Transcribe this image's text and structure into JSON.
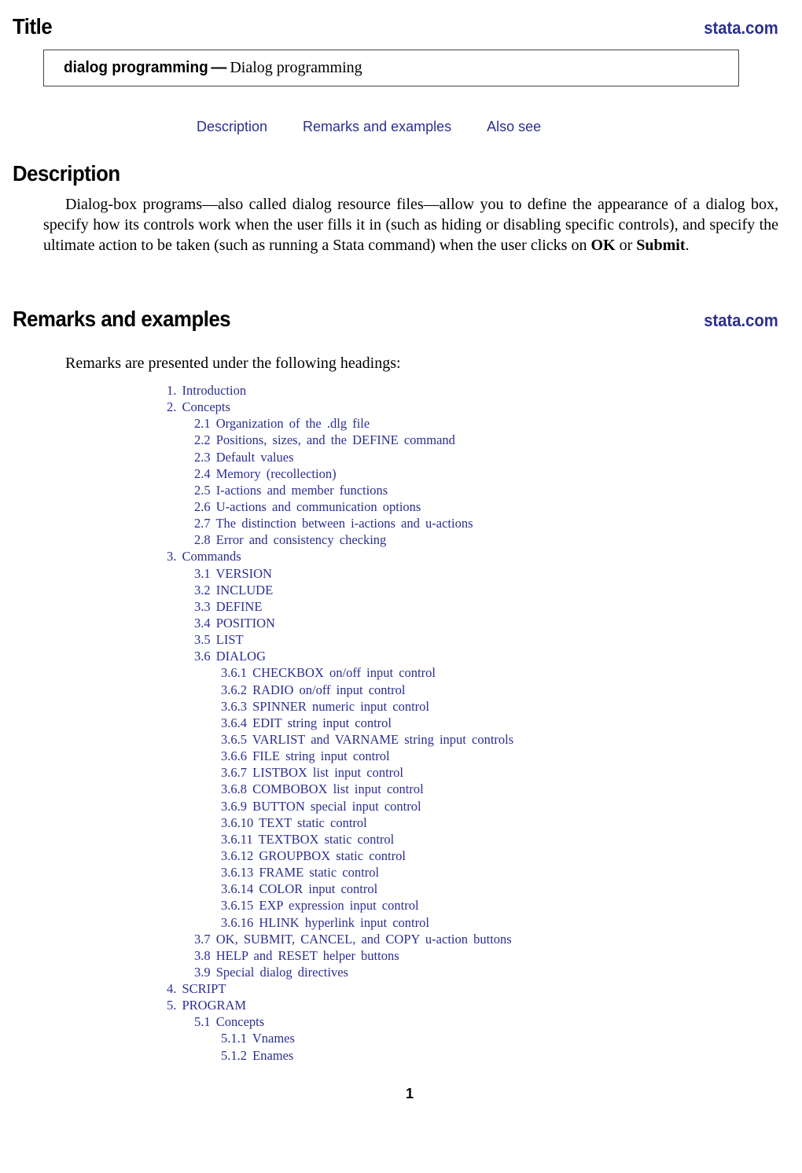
{
  "header": {
    "section_title": "Title",
    "site_link": "stata.com"
  },
  "title_box": {
    "command": "dialog programming",
    "dash": "—",
    "description": "Dialog programming"
  },
  "nav_links": [
    {
      "label": "Description"
    },
    {
      "label": "Remarks and examples"
    },
    {
      "label": "Also see"
    }
  ],
  "description": {
    "heading": "Description",
    "text_before_ok": "Dialog-box programs—also called dialog resource files—allow you to define the appearance of a dialog box, specify how its controls work when the user fills it in (such as hiding or disabling specific controls), and specify the ultimate action to be taken (such as running a Stata command) when the user clicks on ",
    "ok_label": "OK",
    "between": " or ",
    "submit_label": "Submit",
    "end": "."
  },
  "remarks": {
    "heading": "Remarks and examples",
    "site_link": "stata.com",
    "intro": "Remarks are presented under the following headings:",
    "toc": [
      {
        "level": 1,
        "label": "1.  Introduction"
      },
      {
        "level": 1,
        "label": "2.  Concepts"
      },
      {
        "level": 2,
        "label": "2.1 Organization of the .dlg file"
      },
      {
        "level": 2,
        "label": "2.2 Positions, sizes, and the DEFINE command"
      },
      {
        "level": 2,
        "label": "2.3 Default values"
      },
      {
        "level": 2,
        "label": "2.4 Memory (recollection)"
      },
      {
        "level": 2,
        "label": "2.5 I-actions and member functions"
      },
      {
        "level": 2,
        "label": "2.6 U-actions and communication options"
      },
      {
        "level": 2,
        "label": "2.7 The distinction between i-actions and u-actions"
      },
      {
        "level": 2,
        "label": "2.8 Error and consistency checking"
      },
      {
        "level": 1,
        "label": "3.  Commands"
      },
      {
        "level": 2,
        "label": "3.1 VERSION"
      },
      {
        "level": 2,
        "label": "3.2 INCLUDE"
      },
      {
        "level": 2,
        "label": "3.3 DEFINE"
      },
      {
        "level": 2,
        "label": "3.4 POSITION"
      },
      {
        "level": 2,
        "label": "3.5 LIST"
      },
      {
        "level": 2,
        "label": "3.6 DIALOG"
      },
      {
        "level": 3,
        "label": "3.6.1 CHECKBOX on/off input control"
      },
      {
        "level": 3,
        "label": "3.6.2 RADIO on/off input control"
      },
      {
        "level": 3,
        "label": "3.6.3 SPINNER numeric input control"
      },
      {
        "level": 3,
        "label": "3.6.4 EDIT string input control"
      },
      {
        "level": 3,
        "label": "3.6.5 VARLIST and VARNAME string input controls"
      },
      {
        "level": 3,
        "label": "3.6.6 FILE string input control"
      },
      {
        "level": 3,
        "label": "3.6.7 LISTBOX list input control"
      },
      {
        "level": 3,
        "label": "3.6.8 COMBOBOX list input control"
      },
      {
        "level": 3,
        "label": "3.6.9 BUTTON special input control"
      },
      {
        "level": 3,
        "label": "3.6.10 TEXT static control"
      },
      {
        "level": 3,
        "label": "3.6.11 TEXTBOX static control"
      },
      {
        "level": 3,
        "label": "3.6.12 GROUPBOX static control"
      },
      {
        "level": 3,
        "label": "3.6.13 FRAME static control"
      },
      {
        "level": 3,
        "label": "3.6.14 COLOR input control"
      },
      {
        "level": 3,
        "label": "3.6.15 EXP expression input control"
      },
      {
        "level": 3,
        "label": "3.6.16 HLINK hyperlink input control"
      },
      {
        "level": 2,
        "label": "3.7 OK, SUBMIT, CANCEL, and COPY u-action buttons"
      },
      {
        "level": 2,
        "label": "3.8 HELP and RESET helper buttons"
      },
      {
        "level": 2,
        "label": "3.9 Special dialog directives"
      },
      {
        "level": 1,
        "label": "4.  SCRIPT"
      },
      {
        "level": 1,
        "label": "5.  PROGRAM"
      },
      {
        "level": 2,
        "label": "5.1 Concepts"
      },
      {
        "level": 3,
        "label": "5.1.1 Vnames"
      },
      {
        "level": 3,
        "label": "5.1.2 Enames"
      }
    ]
  },
  "footer": {
    "page_number": "1"
  },
  "colors": {
    "link": "#2b2f8f",
    "text": "#000000",
    "box_border": "#444444"
  }
}
